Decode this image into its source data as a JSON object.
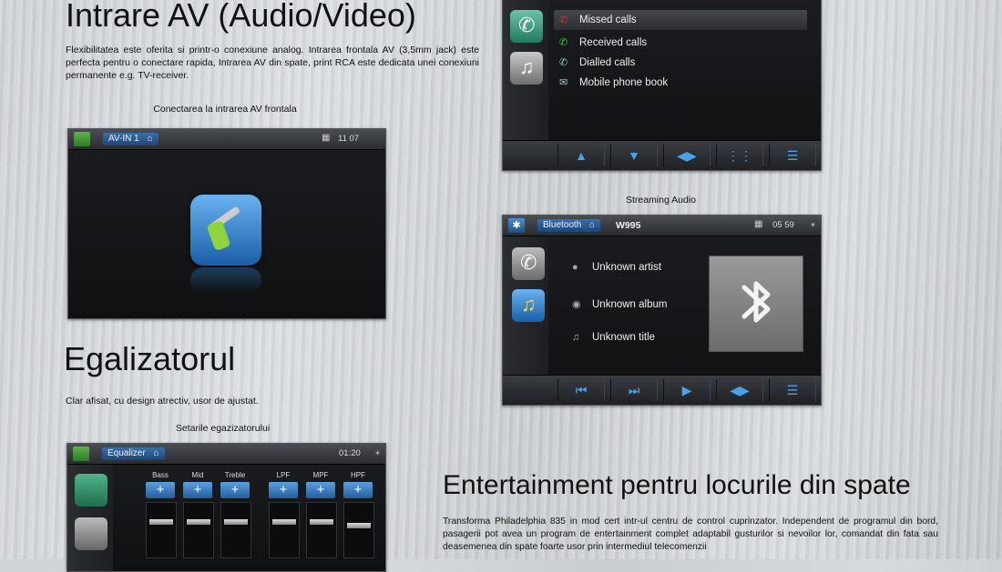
{
  "section_av": {
    "title": "Intrare AV (Audio/Video)",
    "paragraph": "Flexibilitatea este oferita si printr-o conexiune analog. Intrarea frontala  AV (3,5mm jack) este perfecta pentru o conectare rapida, Intrarea AV din spate, print RCA este dedicata unei conexiuni permanente  e.g.  TV-receiver.",
    "caption": "Conectarea la intrarea  AV  frontala"
  },
  "av_screen": {
    "source_label": "AV-IN 1",
    "clock": "11 07",
    "home_icon": "home-icon",
    "main_icon": "audio-jack-icon"
  },
  "section_eq": {
    "title": "Egalizatorul",
    "paragraph": "Clar afisat, cu design atrectiv, usor de ajustat.",
    "caption": "Setarile egazizatorului"
  },
  "eq_screen": {
    "source_label": "Equalizer",
    "clock": "01:20",
    "bands": [
      "Bass",
      "Mid",
      "Treble",
      "LPF",
      "MPF",
      "HPF"
    ]
  },
  "phone_screen": {
    "items": [
      "Missed calls",
      "Received calls",
      "Dialled calls",
      "Mobile phone book"
    ],
    "icons": [
      "missed-call-icon",
      "received-call-icon",
      "dialled-call-icon",
      "phone-book-icon"
    ]
  },
  "section_stream": {
    "caption": "Streaming Audio"
  },
  "bt_screen": {
    "source_label": "Bluetooth",
    "device": "W995",
    "clock": "05 59",
    "artist": "Unknown artist",
    "album": "Unknown album",
    "title": "Unknown title"
  },
  "section_ent": {
    "title": "Entertainment pentru locurile din spate",
    "paragraph": "Transforma Philadelphia 835 in mod cert intr-ul centru de control cuprinzator. Independent de programul din bord, pasagerii pot avea un program de entertainment complet adaptabil gusturilor si nevoilor lor, comandat din fata sau deasemenea din spate foarte usor prin intermediul telecomenzii"
  },
  "colors": {
    "accent_blue": "#3c6ea8",
    "screen_bg": "#15161a",
    "missed_red": "#d33",
    "received_green": "#3c3"
  }
}
